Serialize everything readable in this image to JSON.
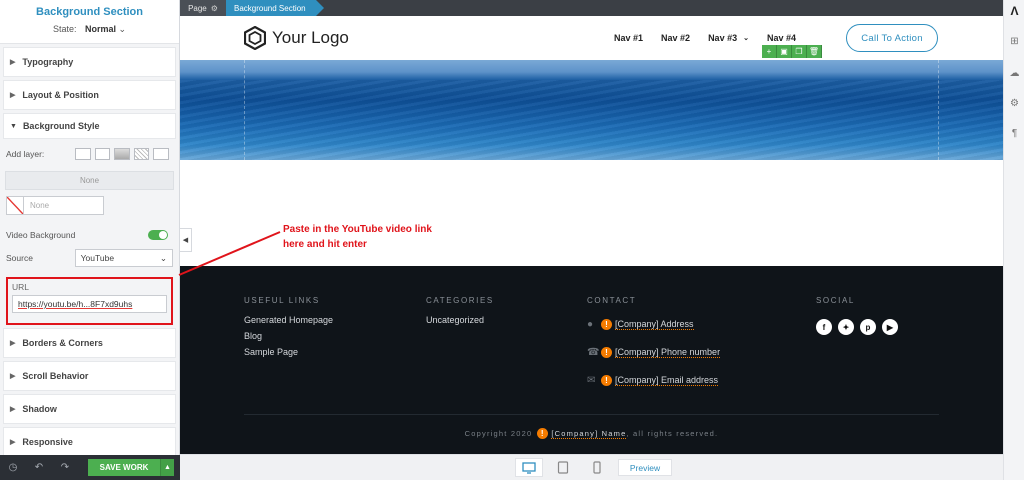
{
  "panel": {
    "title": "Background Section",
    "state_label": "State:",
    "state_value": "Normal",
    "sections_top": [
      "Typography",
      "Layout & Position"
    ],
    "background_style": {
      "title": "Background Style",
      "add_layer_label": "Add layer:",
      "none_bar": "None",
      "color_placeholder": "None",
      "video_background_label": "Video Background",
      "video_background_on": true,
      "source_label": "Source",
      "source_value": "YouTube",
      "url_label": "URL",
      "url_value": "https://youtu.be/h...8F7xd9uhs"
    },
    "sections_bottom": [
      "Borders & Corners",
      "Scroll Behavior",
      "Shadow",
      "Responsive"
    ]
  },
  "bottom_bar": {
    "save_label": "SAVE WORK"
  },
  "breadcrumb": {
    "page": "Page",
    "section": "Background Section"
  },
  "site": {
    "logo_text": "Your Logo",
    "nav": [
      {
        "label": "Nav #1",
        "dropdown": false
      },
      {
        "label": "Nav #2",
        "dropdown": false
      },
      {
        "label": "Nav #3",
        "dropdown": true
      },
      {
        "label": "Nav #4",
        "dropdown": false
      }
    ],
    "cta_label": "Call To Action"
  },
  "annotation": {
    "line1": "Paste in the YouTube video link",
    "line2": "here and hit enter",
    "color": "#e0141b"
  },
  "footer": {
    "useful_links": {
      "heading": "USEFUL LINKS",
      "items": [
        "Generated Homepage",
        "Blog",
        "Sample Page"
      ]
    },
    "categories": {
      "heading": "CATEGORIES",
      "items": [
        "Uncategorized"
      ]
    },
    "contact": {
      "heading": "CONTACT",
      "items": [
        "[Company] Address",
        "[Company] Phone number",
        "[Company] Email address"
      ]
    },
    "social": {
      "heading": "SOCIAL",
      "icons": [
        "facebook-icon",
        "twitter-icon",
        "pinterest-icon",
        "youtube-icon"
      ]
    },
    "copyright_prefix": "Copyright 2020",
    "copyright_company": "[Company] Name",
    "copyright_suffix": ", all rights reserved."
  },
  "device_bar": {
    "preview_label": "Preview",
    "active_device": "desktop"
  },
  "colors": {
    "accent": "#2f8fbf",
    "save_green": "#4caf50",
    "footer_bg": "#0f1419",
    "warning": "#f57c00"
  }
}
